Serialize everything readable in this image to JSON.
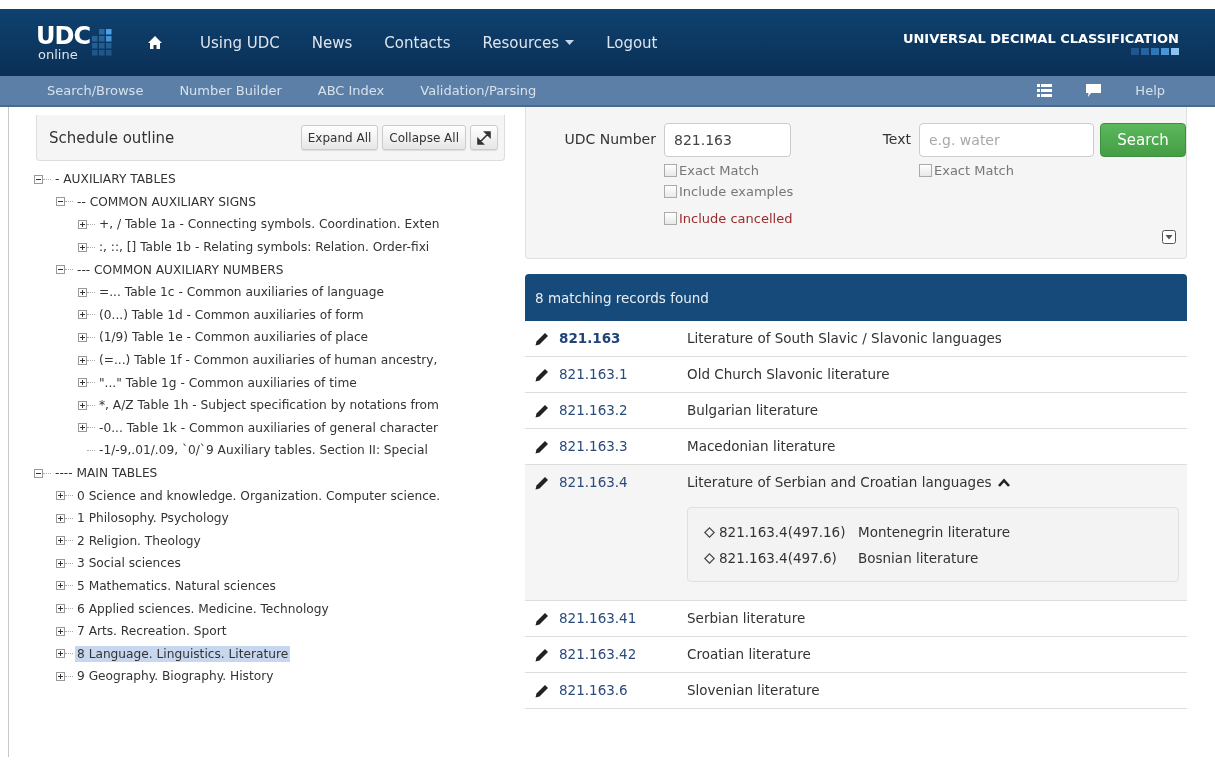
{
  "navbar": {
    "logo": {
      "main": "UDC",
      "sub": "online"
    },
    "items": [
      {
        "kind": "home"
      },
      {
        "kind": "link",
        "label": "Using UDC"
      },
      {
        "kind": "link",
        "label": "News"
      },
      {
        "kind": "link",
        "label": "Contacts"
      },
      {
        "kind": "dropdown",
        "label": "Resources"
      },
      {
        "kind": "link",
        "label": "Logout"
      }
    ],
    "brand": "UNIVERSAL DECIMAL CLASSIFICATION"
  },
  "subnav": {
    "items": [
      "Search/Browse",
      "Number Builder",
      "ABC Index",
      "Validation/Parsing"
    ],
    "right": [
      {
        "kind": "list"
      },
      {
        "kind": "comment"
      },
      {
        "kind": "text",
        "label": "Help"
      }
    ]
  },
  "outline": {
    "title": "Schedule outline",
    "buttons": [
      "Expand All",
      "Collapse All"
    ],
    "tree": [
      {
        "label": "- AUXILIARY TABLES",
        "expanded": true,
        "selected": false,
        "children": [
          {
            "label": "-- COMMON AUXILIARY SIGNS",
            "expanded": true,
            "selected": false,
            "children": [
              {
                "label": "+, / Table 1a - Connecting symbols. Coordination. Exten",
                "expanded": false,
                "selected": false
              },
              {
                "label": ":, ::, [] Table 1b - Relating symbols: Relation. Order-fixi",
                "expanded": false,
                "selected": false
              }
            ]
          },
          {
            "label": "--- COMMON AUXILIARY NUMBERS",
            "expanded": true,
            "selected": false,
            "children": [
              {
                "label": "=... Table 1c - Common auxiliaries of language",
                "expanded": false,
                "selected": false
              },
              {
                "label": "(0...) Table 1d - Common auxiliaries of form",
                "expanded": false,
                "selected": false
              },
              {
                "label": "(1/9) Table 1e - Common auxiliaries of place",
                "expanded": false,
                "selected": false
              },
              {
                "label": "(=...) Table 1f - Common auxiliaries of human ancestry,",
                "expanded": false,
                "selected": false
              },
              {
                "label": "\"...\" Table 1g - Common auxiliaries of time",
                "expanded": false,
                "selected": false
              },
              {
                "label": "*, A/Z Table 1h - Subject specification by notations from",
                "expanded": false,
                "selected": false
              },
              {
                "label": "-0... Table 1k - Common auxiliaries of general character",
                "expanded": false,
                "selected": false
              },
              {
                "label": "-1/-9,.01/.09, `0/`9 Auxiliary tables. Section II: Special",
                "selected": false
              }
            ]
          }
        ]
      },
      {
        "label": "---- MAIN TABLES",
        "expanded": true,
        "selected": false,
        "children": [
          {
            "label": "0 Science and knowledge. Organization. Computer science.",
            "expanded": false,
            "selected": false
          },
          {
            "label": "1 Philosophy. Psychology",
            "expanded": false,
            "selected": false
          },
          {
            "label": "2 Religion. Theology",
            "expanded": false,
            "selected": false
          },
          {
            "label": "3 Social sciences",
            "expanded": false,
            "selected": false
          },
          {
            "label": "5 Mathematics. Natural sciences",
            "expanded": false,
            "selected": false
          },
          {
            "label": "6 Applied sciences. Medicine. Technology",
            "expanded": false,
            "selected": false
          },
          {
            "label": "7 Arts. Recreation. Sport",
            "expanded": false,
            "selected": false
          },
          {
            "label": "8 Language. Linguistics. Literature",
            "expanded": false,
            "selected": true
          },
          {
            "label": "9 Geography. Biography. History",
            "expanded": false,
            "selected": false
          }
        ]
      }
    ]
  },
  "search": {
    "number": {
      "label": "UDC Number",
      "value": "821.163"
    },
    "text": {
      "label": "Text",
      "placeholder": "e.g. water"
    },
    "button": "Search",
    "number_options": [
      {
        "label": "Exact Match",
        "checked": false,
        "kind": "normal"
      },
      {
        "label": "Include examples",
        "checked": false,
        "kind": "normal"
      },
      {
        "label": "Include cancelled",
        "checked": false,
        "kind": "danger"
      }
    ],
    "text_options": [
      {
        "label": "Exact Match",
        "checked": false,
        "kind": "normal"
      }
    ]
  },
  "results": {
    "summary": "8 matching records found",
    "rows": [
      {
        "code": "821.163",
        "title": "Literature of South Slavic / Slavonic languages",
        "current": true,
        "expanded": false
      },
      {
        "code": "821.163.1",
        "title": "Old Church Slavonic literature",
        "current": false,
        "expanded": false
      },
      {
        "code": "821.163.2",
        "title": "Bulgarian literature",
        "current": false,
        "expanded": false
      },
      {
        "code": "821.163.3",
        "title": "Macedonian literature",
        "current": false,
        "expanded": false
      },
      {
        "code": "821.163.4",
        "title": "Literature of Serbian and Croatian languages",
        "current": false,
        "expanded": true,
        "examples": [
          {
            "code": "821.163.4(497.16)",
            "title": "Montenegrin literature"
          },
          {
            "code": "821.163.4(497.6)",
            "title": "Bosnian literature"
          }
        ]
      },
      {
        "code": "821.163.41",
        "title": "Serbian literature",
        "current": false,
        "expanded": false
      },
      {
        "code": "821.163.42",
        "title": "Croatian literature",
        "current": false,
        "expanded": false
      },
      {
        "code": "821.163.6",
        "title": "Slovenian literature",
        "current": false,
        "expanded": false
      }
    ]
  }
}
